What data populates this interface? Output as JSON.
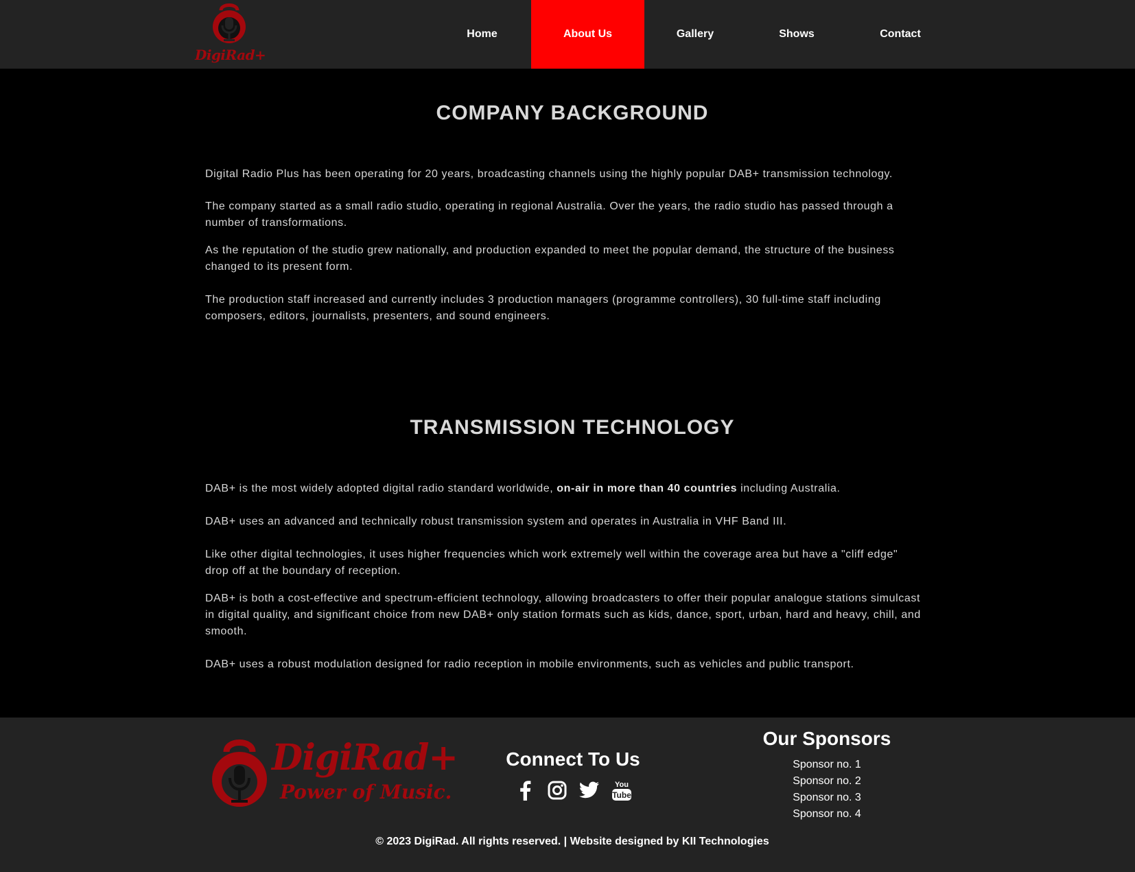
{
  "brand": {
    "logo_text": "DigiRad+",
    "tagline": "Power of Music.",
    "accent_color": "#ff0000",
    "logo_color": "#a3080d"
  },
  "nav": {
    "items": [
      {
        "label": "Home",
        "active": false
      },
      {
        "label": "About Us",
        "active": true
      },
      {
        "label": "Gallery",
        "active": false
      },
      {
        "label": "Shows",
        "active": false
      },
      {
        "label": "Contact",
        "active": false
      }
    ]
  },
  "sections": {
    "background": {
      "title": "COMPANY BACKGROUND",
      "paragraphs": [
        "Digital Radio Plus has been operating for 20 years, broadcasting channels using the highly popular DAB+ transmission technology.",
        "The company started as a small radio studio, operating in regional Australia. Over the years, the radio studio has passed through a number of transformations.",
        "As the reputation of the studio grew nationally, and production expanded to meet the popular demand, the structure of the business changed to its present form.",
        "The production staff increased and currently includes 3 production managers (programme controllers), 30 full-time staff including composers, editors, journalists, presenters, and sound engineers."
      ]
    },
    "technology": {
      "title": "TRANSMISSION TECHNOLOGY",
      "p1_start": "DAB+ is the most widely adopted digital radio standard worldwide, ",
      "p1_bold": "on-air in more than 40 countries",
      "p1_end": " including Australia.",
      "paragraphs": [
        "DAB+ uses an advanced and technically robust transmission system and operates in Australia in VHF Band III.",
        "Like other digital technologies, it uses higher frequencies which work extremely well within the coverage area but have a \"cliff edge\" drop off at the boundary of reception.",
        "DAB+ is both a cost-effective and spectrum-efficient technology, allowing broadcasters to offer their popular analogue stations simulcast in digital quality, and significant choice from new DAB+ only station formats such as kids, dance, sport, urban, hard and heavy, chill, and smooth.",
        "DAB+ uses a robust modulation designed for radio reception in mobile environments, such as vehicles and public transport."
      ]
    }
  },
  "footer": {
    "connect_title": "Connect To Us",
    "social_icons": [
      "facebook-icon",
      "instagram-icon",
      "twitter-icon",
      "youtube-icon"
    ],
    "sponsors_title": "Our Sponsors",
    "sponsors": [
      "Sponsor no. 1",
      "Sponsor no. 2",
      "Sponsor no. 3",
      "Sponsor no. 4"
    ],
    "copyright": "© 2023 DigiRad. All rights reserved. | Website designed by KII Technologies"
  }
}
